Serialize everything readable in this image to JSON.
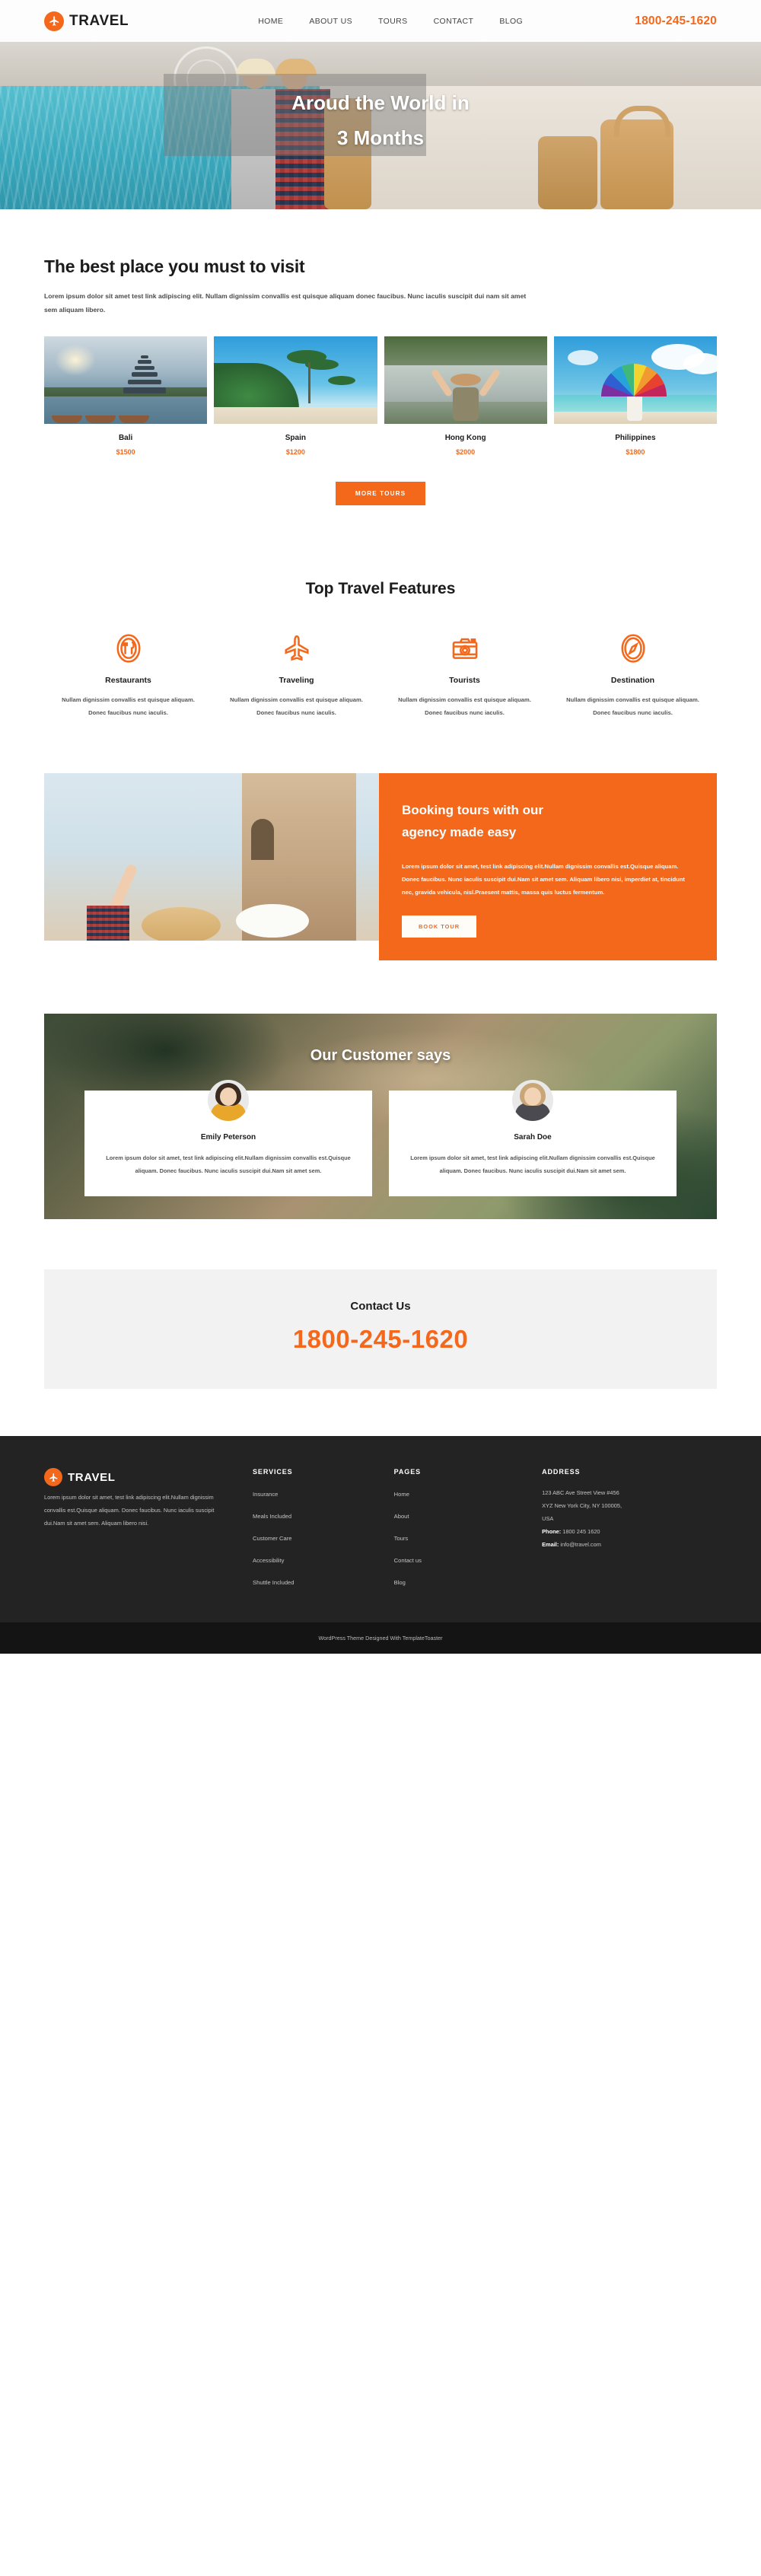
{
  "brand": {
    "name": "TRAVEL",
    "icon": "airplane-icon",
    "accent": "#F4681C"
  },
  "header": {
    "nav": [
      {
        "label": "HOME"
      },
      {
        "label": "ABOUT US"
      },
      {
        "label": "TOURS"
      },
      {
        "label": "CONTACT"
      },
      {
        "label": "BLOG"
      }
    ],
    "phone": "1800-245-1620"
  },
  "hero": {
    "line1": "Aroud the World in",
    "line2": "3 Months"
  },
  "best": {
    "title": "The best place you must to visit",
    "description": "Lorem ipsum dolor sit amet test link adipiscing elit. Nullam dignissim convallis est quisque aliquam donec faucibus. Nunc iaculis suscipit dui nam sit amet sem aliquam libero.",
    "cards": [
      {
        "name": "Bali",
        "price": "$1500",
        "image": "bali-temple-lake-boats"
      },
      {
        "name": "Spain",
        "price": "$1200",
        "image": "tropical-palm-beach"
      },
      {
        "name": "Hong Kong",
        "price": "$2000",
        "image": "hiker-arms-raised-waterfall"
      },
      {
        "name": "Philippines",
        "price": "$1800",
        "image": "rainbow-umbrella-beach"
      }
    ],
    "more_button": "MORE TOURS"
  },
  "features": {
    "title": "Top Travel Features",
    "items": [
      {
        "name": "Restaurants",
        "icon": "plate-cutlery-icon",
        "desc": "Nullam dignissim convallis est quisque aliquam. Donec faucibus nunc iaculis."
      },
      {
        "name": "Traveling",
        "icon": "airplane-icon",
        "desc": "Nullam dignissim convallis est quisque aliquam. Donec faucibus nunc iaculis."
      },
      {
        "name": "Tourists",
        "icon": "camera-icon",
        "desc": "Nullam dignissim convallis est quisque aliquam. Donec faucibus nunc iaculis."
      },
      {
        "name": "Destination",
        "icon": "compass-icon",
        "desc": "Nullam dignissim convallis est quisque aliquam. Donec faucibus nunc iaculis."
      }
    ]
  },
  "booking": {
    "image": "tourists-pointing-at-building",
    "heading_line1": "Booking tours with our",
    "heading_line2": "agency made easy",
    "paragraph": "Lorem ipsum dolor sit amet, test link adipiscing elit.Nullam dignissim convallis est.Quisque aliquam. Donec faucibus. Nunc iaculis suscipit dui.Nam sit amet sem. Aliquam libero nisi, imperdiet at, tincidunt nec, gravida vehicula, nisl.Praesent mattis, massa quis luctus fermentum.",
    "button": "BOOK TOUR"
  },
  "testimonials": {
    "title": "Our Customer says",
    "background": "aerial-beach-resort",
    "items": [
      {
        "name": "Emily Peterson",
        "avatar": "woman-yellow-top",
        "hair": "#3a2a20",
        "body": "#e8a72a",
        "text": "Lorem ipsum dolor sit amet, test link adipiscing elit.Nullam dignissim convallis est.Quisque aliquam. Donec faucibus. Nunc iaculis suscipit dui.Nam sit amet sem."
      },
      {
        "name": "Sarah Doe",
        "avatar": "woman-gray-top",
        "hair": "#c9a678",
        "body": "#4a4a50",
        "text": "Lorem ipsum dolor sit amet, test link adipiscing elit.Nullam dignissim convallis est.Quisque aliquam. Donec faucibus. Nunc iaculis suscipit dui.Nam sit amet sem."
      }
    ]
  },
  "contact": {
    "title": "Contact Us",
    "number": "1800-245-1620"
  },
  "footer": {
    "about": "Lorem ipsum dolor sit amet, test link adipiscing elit.Nullam dignissim convallis est.Quisque aliquam. Donec faucibus. Nunc iaculis suscipit dui.Nam sit amet sem. Aliquam libero nisi.",
    "services_head": "SERVICES",
    "services": [
      {
        "label": "Insurance"
      },
      {
        "label": "Meals Included"
      },
      {
        "label": "Customer Care"
      },
      {
        "label": "Accessibility"
      },
      {
        "label": "Shuttle Included"
      }
    ],
    "pages_head": "PAGES",
    "pages": [
      {
        "label": "Home"
      },
      {
        "label": "About"
      },
      {
        "label": "Tours"
      },
      {
        "label": "Contact us"
      },
      {
        "label": "Blog"
      }
    ],
    "address_head": "ADDRESS",
    "address_line1": "123 ABC Ave Street View #456",
    "address_line2": "XYZ New York City, NY 100005,",
    "address_line3": "USA",
    "phone_label": "Phone:",
    "phone_value": " 1800 245 1620",
    "email_label": "Email:",
    "email_value": " info@travel.com",
    "copyright": "WordPress Theme Designed With TemplateToaster"
  }
}
